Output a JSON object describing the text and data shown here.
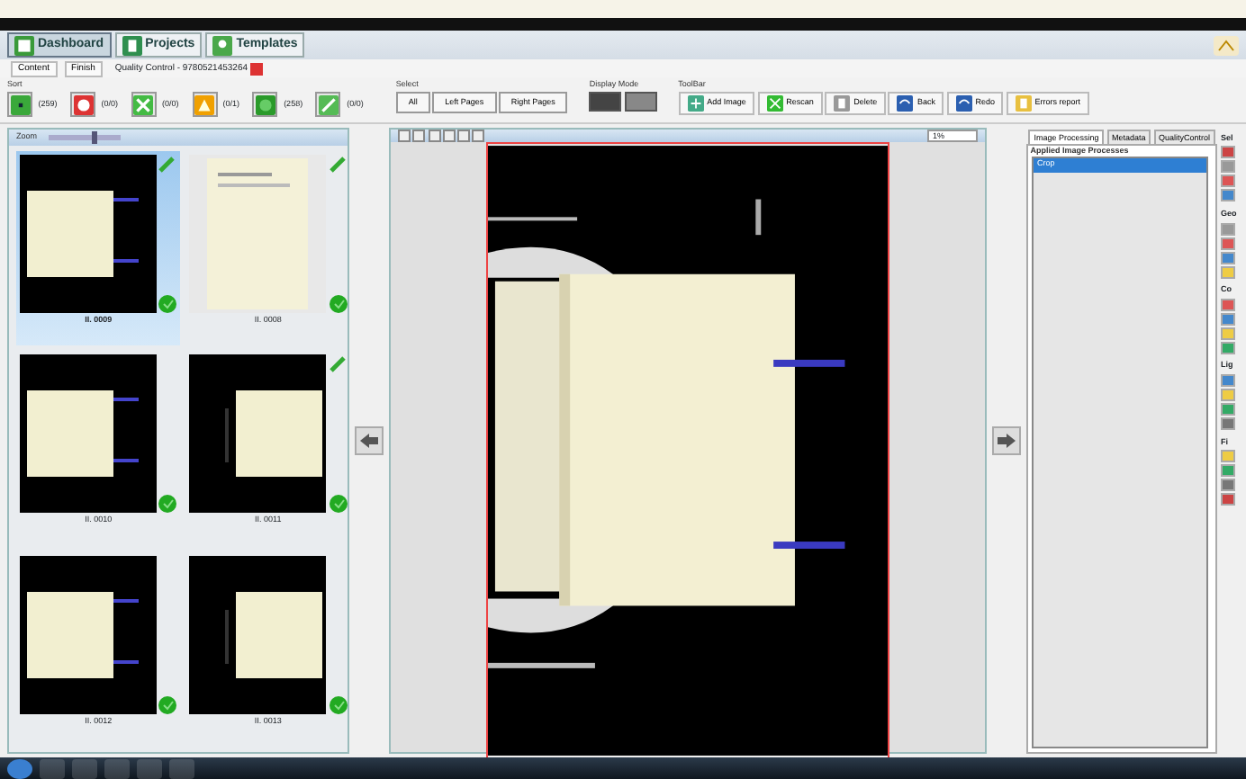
{
  "main_tabs": [
    {
      "label": "Dashboard",
      "selected": true,
      "kind": "dashboard"
    },
    {
      "label": "Projects",
      "selected": false,
      "kind": "projects"
    },
    {
      "label": "Templates",
      "selected": false,
      "kind": "templates"
    }
  ],
  "breadcrumb": [
    {
      "label": "Content",
      "kind": "link"
    },
    {
      "label": "Finish",
      "kind": "link"
    },
    {
      "label": "Quality Control - 9780521453264",
      "kind": "current"
    }
  ],
  "sort": {
    "title": "Sort",
    "filters": [
      {
        "kind": "all",
        "count": "(259)"
      },
      {
        "kind": "error",
        "count": "(0/0)"
      },
      {
        "kind": "cross",
        "count": "(0/0)"
      },
      {
        "kind": "warning",
        "count": "(0/1)"
      },
      {
        "kind": "ok",
        "count": "(258)"
      },
      {
        "kind": "edit",
        "count": "(0/0)"
      }
    ]
  },
  "select": {
    "title": "Select",
    "buttons": [
      "All",
      "Left Pages",
      "Right Pages"
    ]
  },
  "display_mode": {
    "title": "Display Mode",
    "modes": [
      {
        "selected": true
      },
      {
        "selected": false
      }
    ]
  },
  "toolbar": {
    "title": "ToolBar",
    "buttons": [
      {
        "kind": "add",
        "label": "Add Image"
      },
      {
        "kind": "rescan",
        "label": "Rescan"
      },
      {
        "kind": "delete",
        "label": "Delete"
      },
      {
        "kind": "back",
        "label": "Back"
      },
      {
        "kind": "redo",
        "label": "Redo"
      },
      {
        "kind": "report",
        "label": "Errors report"
      }
    ]
  },
  "thumbnails": {
    "zoom_label": "Zoom",
    "zoom_level": {
      "level": 0.65
    },
    "items": [
      {
        "label": "II. 0009",
        "selected": true,
        "kind": "spread",
        "edited": true,
        "approved": true
      },
      {
        "label": "II. 0008",
        "selected": false,
        "kind": "page",
        "edited": true,
        "approved": true
      },
      {
        "label": "II. 0010",
        "selected": false,
        "kind": "spread",
        "edited": false,
        "approved": true
      },
      {
        "label": "II. 0011",
        "selected": false,
        "kind": "spread-right",
        "edited": true,
        "approved": true
      },
      {
        "label": "II. 0012",
        "selected": false,
        "kind": "spread",
        "edited": false,
        "approved": true
      },
      {
        "label": "II. 0013",
        "selected": false,
        "kind": "spread-right",
        "edited": false,
        "approved": true
      }
    ]
  },
  "viewer": {
    "zoom": "1%"
  },
  "side_tabs": [
    {
      "label": "Image Processing",
      "selected": true
    },
    {
      "label": "Metadata",
      "selected": false
    },
    {
      "label": "QualityControl",
      "selected": false
    }
  ],
  "processes": {
    "title": "Applied Image Processes",
    "items": [
      {
        "label": "Crop",
        "selected": true
      }
    ]
  },
  "tool_strip": [
    "Sel",
    "Geo",
    "Co",
    "Lig",
    "Fi"
  ]
}
